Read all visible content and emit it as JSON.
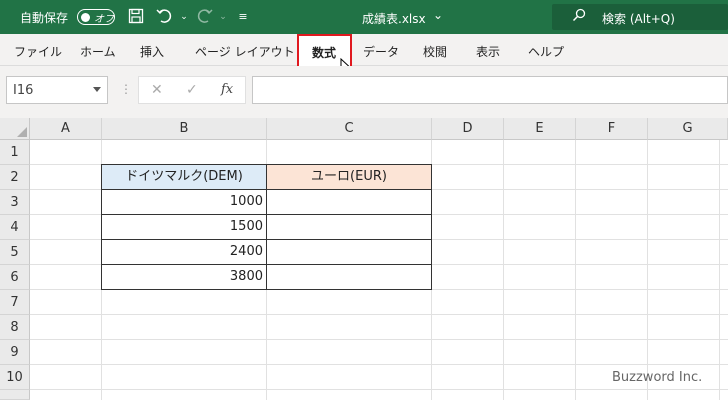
{
  "titlebar": {
    "autosave_label": "自動保存",
    "toggle_label": "オフ",
    "filename": "成績表.xlsx",
    "search_label": "検索 (Alt+Q)"
  },
  "ribbon": {
    "tabs": [
      "ファイル",
      "ホーム",
      "挿入",
      "ページ レイアウト",
      "数式",
      "データ",
      "校閲",
      "表示",
      "ヘルプ"
    ],
    "selected_tab": "数式"
  },
  "formula_bar": {
    "name_box": "I16",
    "value": ""
  },
  "sheet": {
    "columns": [
      "A",
      "B",
      "C",
      "D",
      "E",
      "F",
      "G"
    ],
    "rows": [
      "1",
      "2",
      "3",
      "4",
      "5",
      "6",
      "7",
      "8",
      "9",
      "10"
    ],
    "table": {
      "header_b": "ドイツマルク(DEM)",
      "header_c": "ユーロ(EUR)",
      "values_b": [
        "1000",
        "1500",
        "2400",
        "3800"
      ],
      "values_c": [
        "",
        "",
        "",
        ""
      ]
    }
  },
  "watermark": "Buzzword Inc.",
  "colors": {
    "excel_green": "#217346",
    "highlight_red": "#e0191f",
    "header_blue": "#ddebf7",
    "header_peach": "#fce4d6"
  }
}
